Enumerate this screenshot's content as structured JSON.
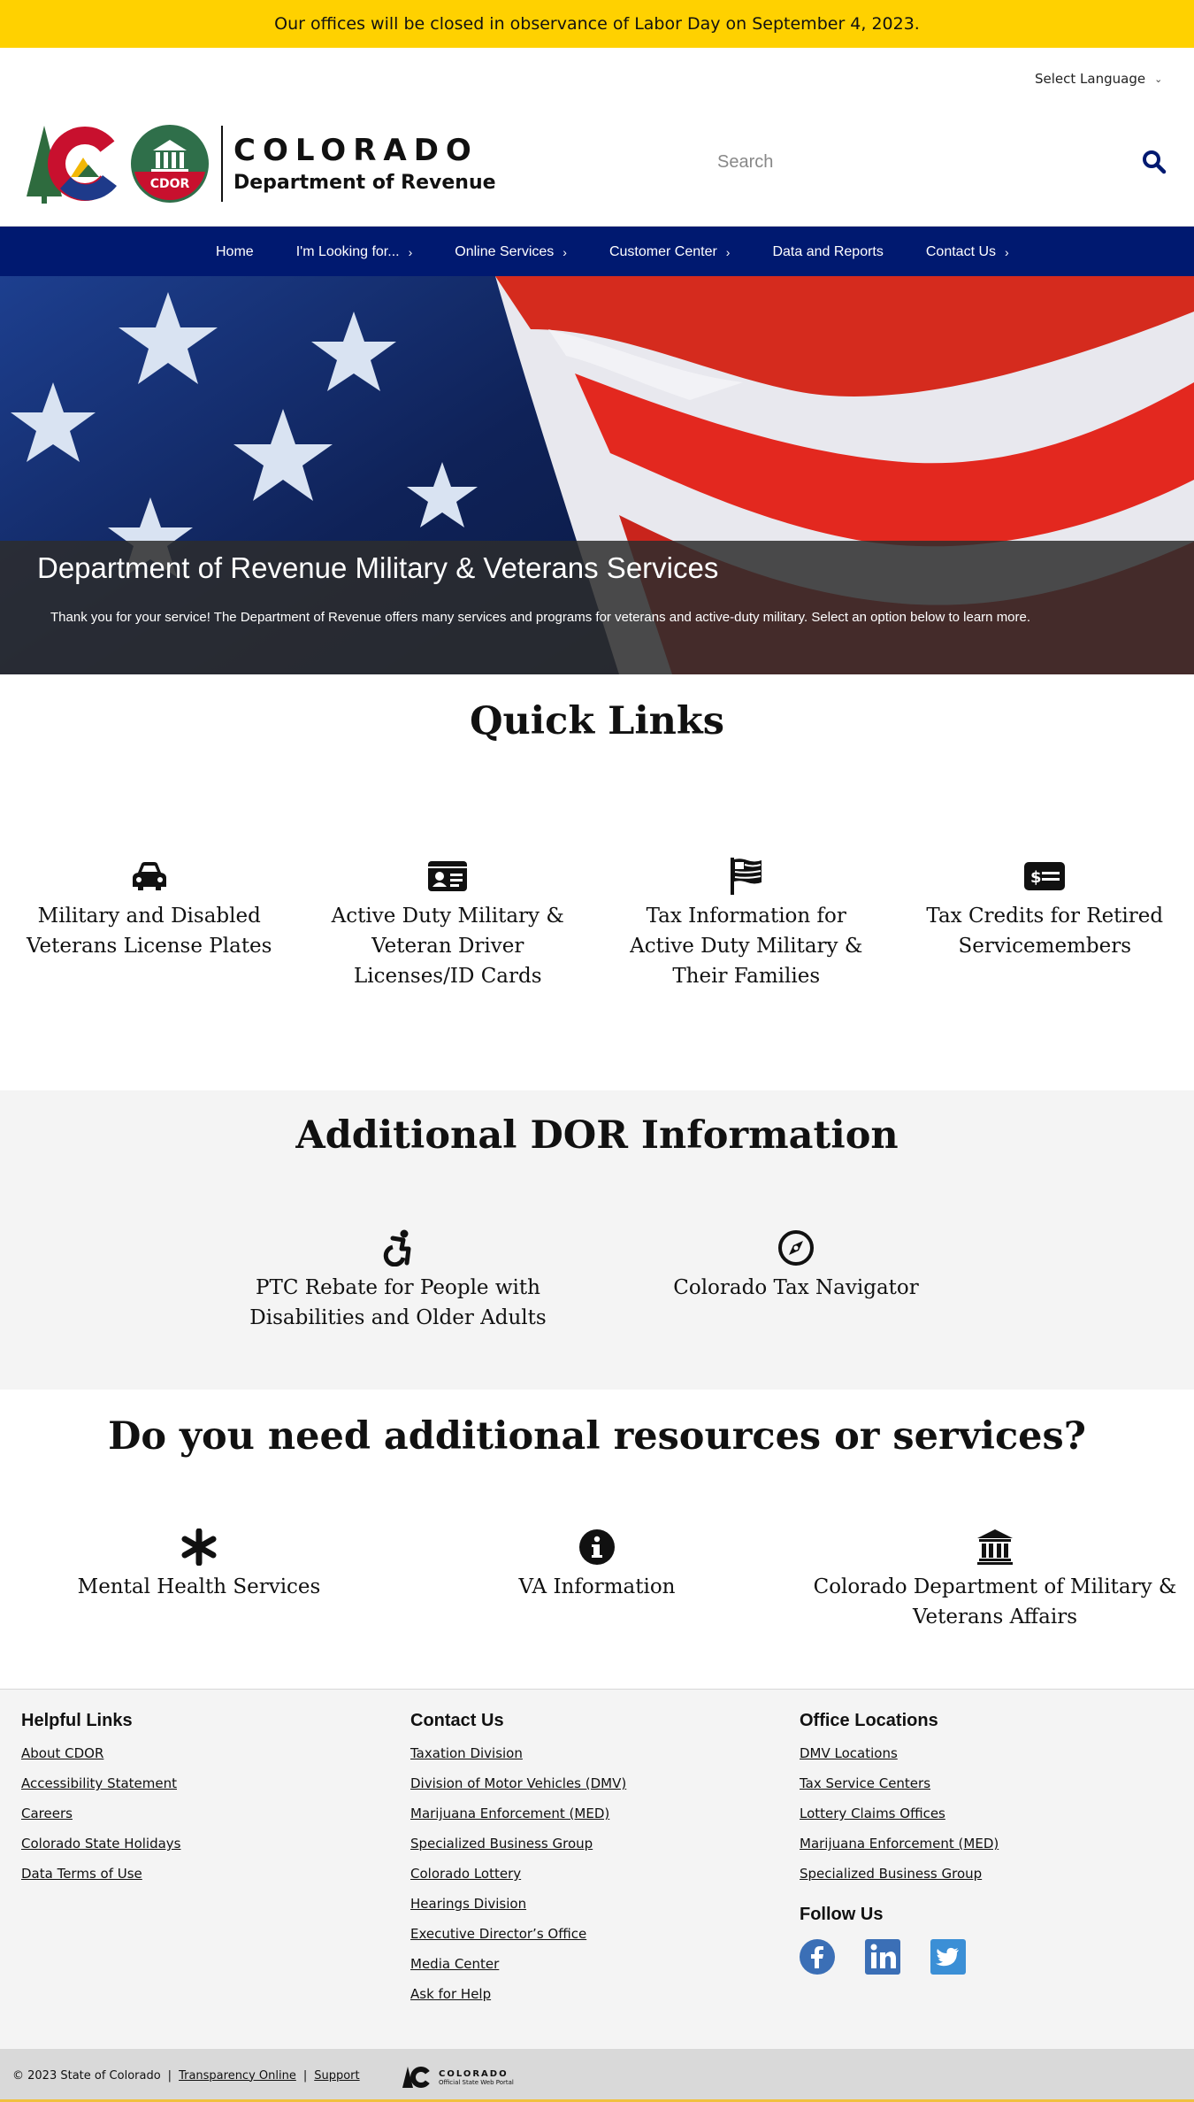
{
  "alert": {
    "text": "Our offices will be closed in observance of Labor Day on September 4, 2023.",
    "color": "#ffd100"
  },
  "header": {
    "language_label": "Select Language",
    "brand_title": "COLORADO",
    "brand_subtitle": "Department of Revenue",
    "cdor_badge": "CDOR",
    "search_placeholder": "Search"
  },
  "nav": {
    "color": "#001970",
    "items": [
      {
        "label": "Home",
        "has_submenu": false
      },
      {
        "label": "I'm Looking for...",
        "has_submenu": true
      },
      {
        "label": "Online Services",
        "has_submenu": true
      },
      {
        "label": "Customer Center",
        "has_submenu": true
      },
      {
        "label": "Data and Reports",
        "has_submenu": false
      },
      {
        "label": "Contact Us",
        "has_submenu": true
      }
    ]
  },
  "hero": {
    "title": "Department of Revenue Military & Veterans Services",
    "text": "Thank you for your service! The Department of Revenue offers many services and programs for veterans and active-duty military. Select an option below to learn more."
  },
  "quick_links": {
    "title": "Quick Links",
    "items": [
      {
        "label": "Military and Disabled Veterans License Plates",
        "icon": "car-icon"
      },
      {
        "label": "Active Duty Military & Veteran Driver Licenses/ID Cards",
        "icon": "id-card-icon"
      },
      {
        "label": "Tax Information for Active Duty Military & Their Families",
        "icon": "flag-icon"
      },
      {
        "label": "Tax Credits for Retired Servicemembers",
        "icon": "money-bill-icon"
      }
    ]
  },
  "dor_info": {
    "title": "Additional DOR Information",
    "items": [
      {
        "label": "PTC Rebate for People with Disabilities and Older Adults",
        "icon": "accessibility-icon"
      },
      {
        "label": "Colorado Tax Navigator",
        "icon": "compass-icon"
      }
    ]
  },
  "resources": {
    "title": "Do you need additional resources or services?",
    "items": [
      {
        "label": "Mental Health Services",
        "icon": "asterisk-icon"
      },
      {
        "label": "VA Information",
        "icon": "info-icon"
      },
      {
        "label": "Colorado Department of Military & Veterans Affairs",
        "icon": "building-columns-icon"
      }
    ]
  },
  "footer": {
    "helpful": {
      "title": "Helpful Links",
      "links": [
        "About CDOR",
        "Accessibility Statement",
        "Careers",
        "Colorado State Holidays",
        "Data Terms of Use"
      ]
    },
    "contact": {
      "title": "Contact Us",
      "links": [
        "Taxation Division",
        "Division of Motor Vehicles (DMV)",
        "Marijuana Enforcement (MED)",
        "Specialized Business Group",
        "Colorado Lottery",
        "Hearings Division",
        "Executive Director’s Office",
        "Media Center",
        "Ask for Help"
      ]
    },
    "offices": {
      "title": "Office Locations",
      "links": [
        "DMV Locations",
        "Tax Service Centers",
        "Lottery Claims Offices",
        "Marijuana Enforcement (MED)",
        "Specialized Business Group"
      ]
    },
    "follow": {
      "title": "Follow Us",
      "networks": [
        "facebook-icon",
        "linkedin-icon",
        "twitter-icon"
      ]
    }
  },
  "bottom_bar": {
    "copyright": "© 2023 State of Colorado",
    "transparency": "Transparency Online",
    "support": "Support",
    "portal_title": "COLORADO",
    "portal_sub": "Official State Web Portal"
  }
}
